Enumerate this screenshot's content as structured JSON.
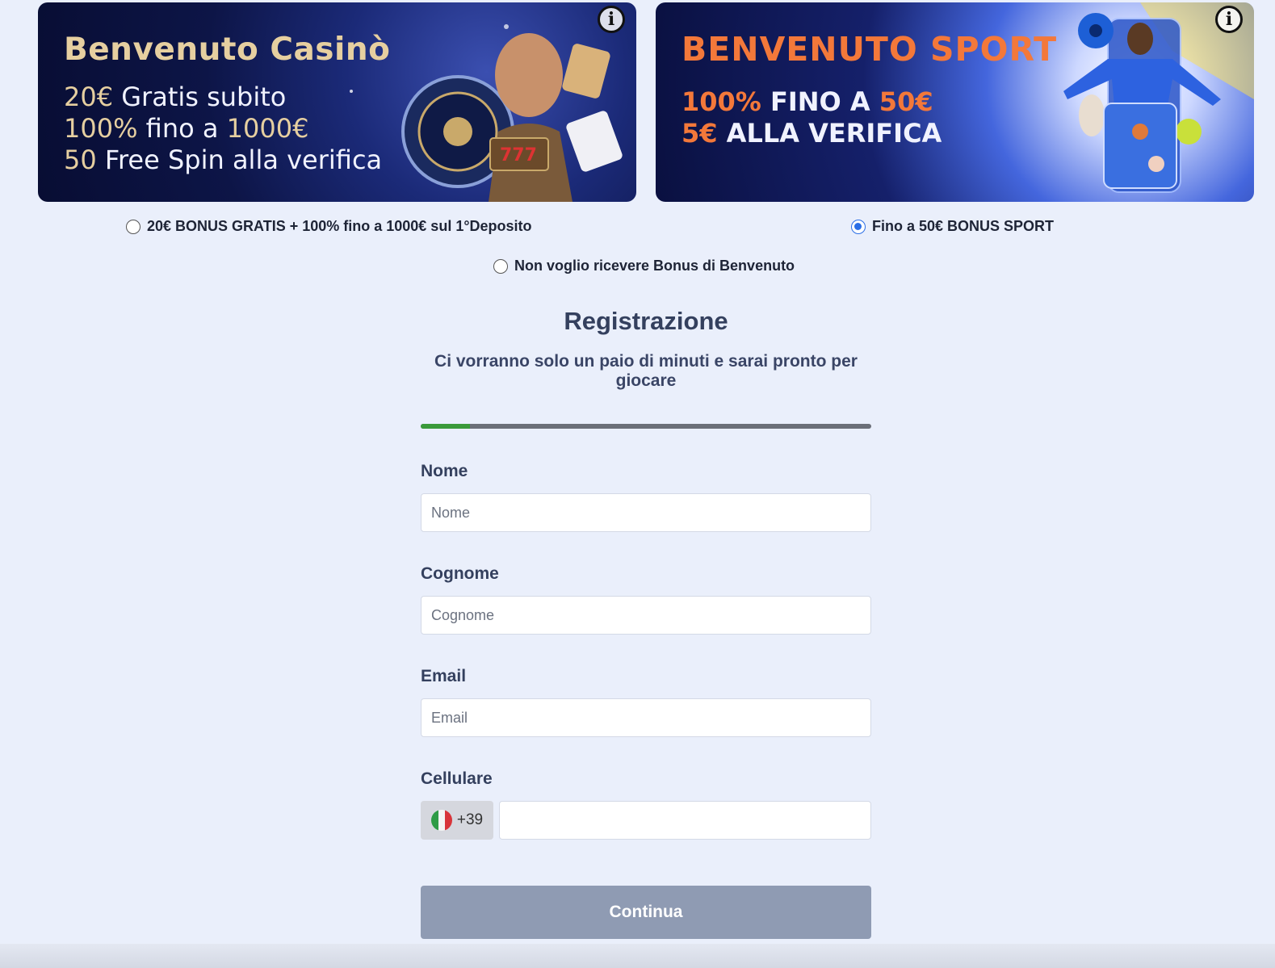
{
  "banners": {
    "casino": {
      "title": "Benvenuto Casinò",
      "line1_accent": "20€",
      "line1_rest": " Gratis subito",
      "line2_accent": "100%",
      "line2_mid": " fino a ",
      "line2_accent2": "1000€",
      "line3_accent": "50",
      "line3_rest": " Free Spin alla verifica",
      "info_icon": "info-icon"
    },
    "sport": {
      "title": "BENVENUTO SPORT",
      "line1_accent": "100%",
      "line1_mid": " FINO A ",
      "line1_accent2": "50€",
      "line2_accent": "5€",
      "line2_rest": " ALLA VERIFICA",
      "info_icon": "info-icon"
    }
  },
  "bonus_options": [
    {
      "label": "20€ BONUS GRATIS + 100% fino a 1000€ sul 1°Deposito",
      "checked": false
    },
    {
      "label": "Fino a 50€ BONUS SPORT",
      "checked": true
    },
    {
      "label": "Non voglio ricevere Bonus di Benvenuto",
      "checked": false
    }
  ],
  "form": {
    "title": "Registrazione",
    "subtitle": "Ci vorranno solo un paio di minuti e sarai pronto per giocare",
    "progress_fraction": 0.11,
    "fields": {
      "nome": {
        "label": "Nome",
        "placeholder": "Nome",
        "value": ""
      },
      "cognome": {
        "label": "Cognome",
        "placeholder": "Cognome",
        "value": ""
      },
      "email": {
        "label": "Email",
        "placeholder": "Email",
        "value": ""
      },
      "cellulare": {
        "label": "Cellulare",
        "prefix": "+39",
        "value": ""
      }
    },
    "submit_label": "Continua"
  },
  "colors": {
    "page_bg": "#eaeffb",
    "progress_fill": "#3a9a3a",
    "radio_checked": "#2a6ee6",
    "button_bg": "#8f9bb3",
    "sport_accent": "#f3783a",
    "casino_accent": "#e6cfa0"
  }
}
